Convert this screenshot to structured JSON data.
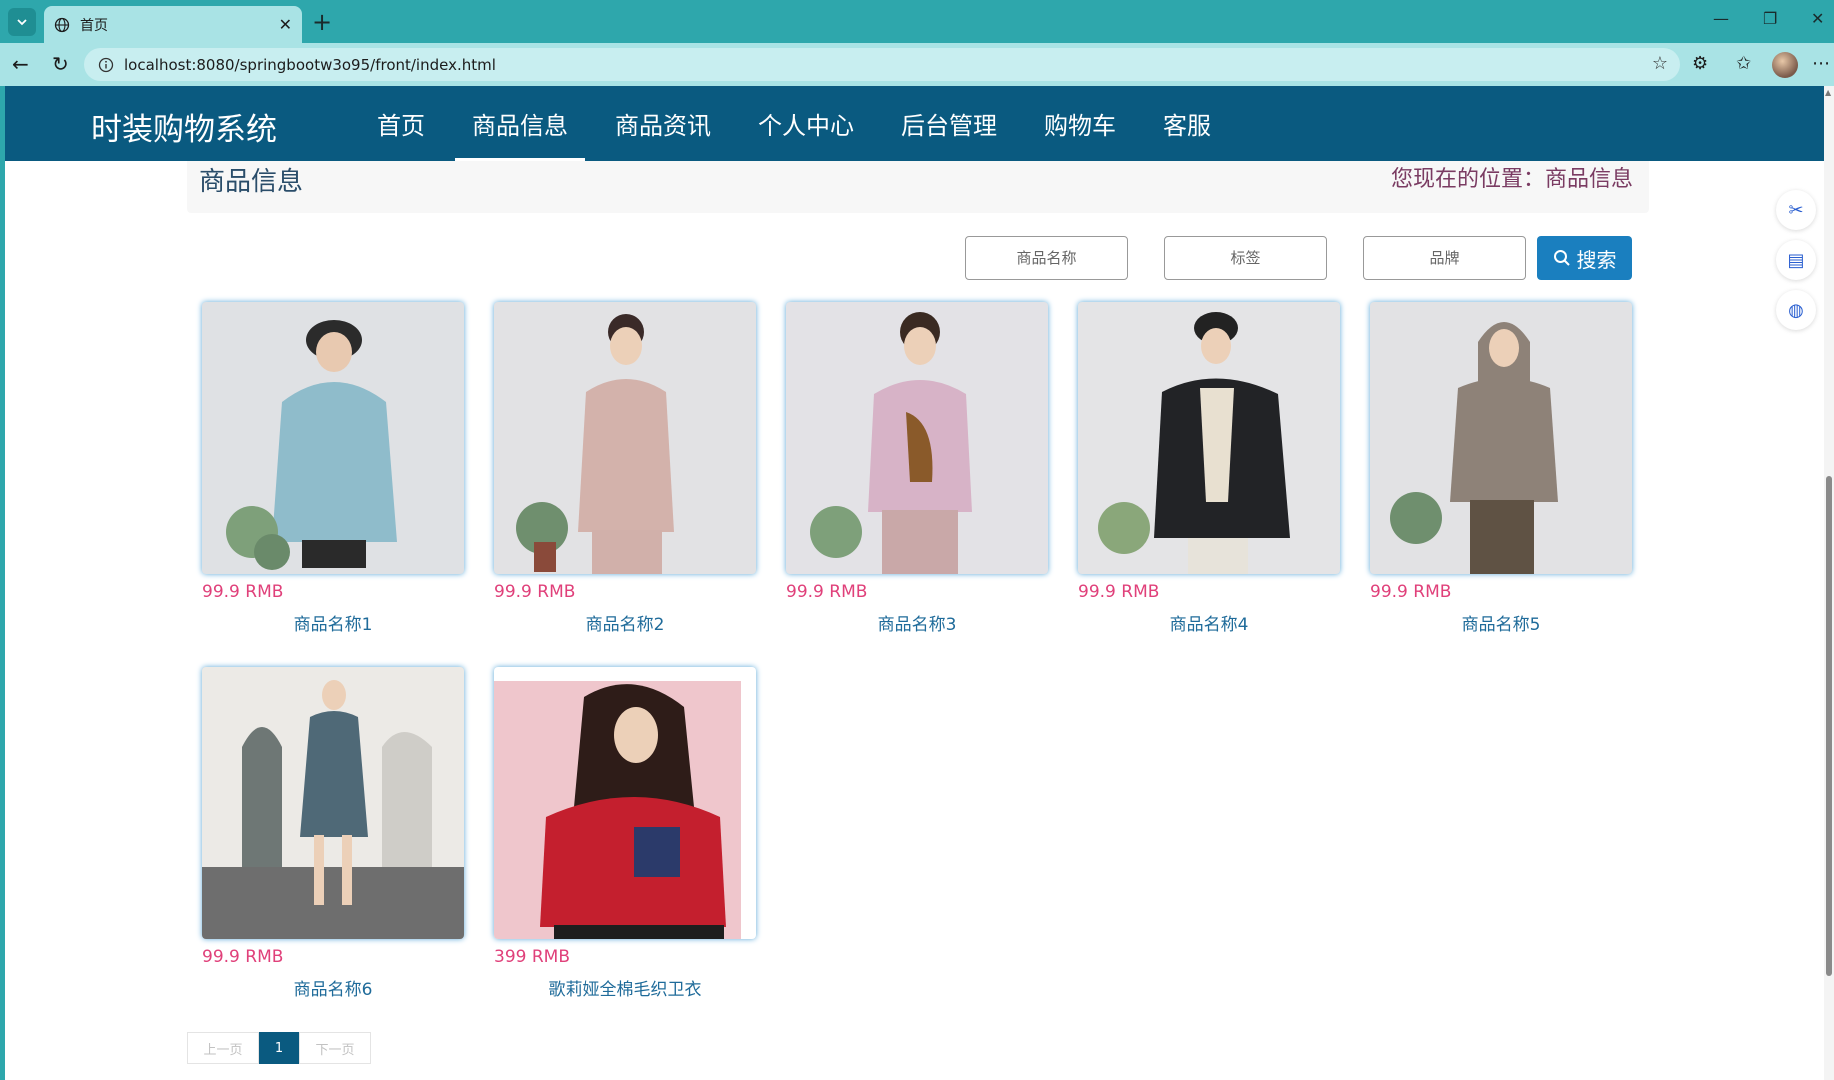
{
  "browser": {
    "tab_title": "首页",
    "url": "localhost:8080/springbootw3o95/front/index.html"
  },
  "site": {
    "title": "时装购物系统"
  },
  "nav": {
    "items": [
      "首页",
      "商品信息",
      "商品资讯",
      "个人中心",
      "后台管理",
      "购物车",
      "客服"
    ],
    "active": "商品信息"
  },
  "breadcrumb": {
    "title": "商品信息",
    "position": "您现在的位置：商品信息"
  },
  "search": {
    "name_placeholder": "商品名称",
    "tag_placeholder": "标签",
    "brand_placeholder": "品牌",
    "button_label": "搜索"
  },
  "products": [
    {
      "price": "99.9 RMB",
      "name": "商品名称1",
      "colors": {
        "bg": "#dfe1e4",
        "top": "#8fbccb",
        "accent": "#2b2b2b"
      }
    },
    {
      "price": "99.9 RMB",
      "name": "商品名称2",
      "colors": {
        "bg": "#e2e2e4",
        "top": "#d3b2ab",
        "accent": "#3a2a28"
      }
    },
    {
      "price": "99.9 RMB",
      "name": "商品名称3",
      "colors": {
        "bg": "#e3e2e6",
        "top": "#d7b3c7",
        "accent": "#8a5a2a"
      }
    },
    {
      "price": "99.9 RMB",
      "name": "商品名称4",
      "colors": {
        "bg": "#e4e4e6",
        "top": "#222326",
        "accent": "#e8e0d0"
      }
    },
    {
      "price": "99.9 RMB",
      "name": "商品名称5",
      "colors": {
        "bg": "#e2e2e4",
        "top": "#8e8278",
        "accent": "#5f5244"
      }
    },
    {
      "price": "99.9 RMB",
      "name": "商品名称6",
      "colors": {
        "bg": "#d8d8d6",
        "top": "#4f6977",
        "accent": "#6e6e6e"
      }
    },
    {
      "price": "399 RMB",
      "name": "歌莉娅全棉毛织卫衣",
      "colors": {
        "bg": "#efc6cc",
        "top": "#c41f2e",
        "accent": "#2e1c18"
      }
    }
  ],
  "pager": {
    "prev": "上一页",
    "current": "1",
    "next": "下一页"
  },
  "icons": {
    "side_tools": [
      "scissors-icon",
      "clipboard-icon",
      "search-assist-icon"
    ]
  }
}
